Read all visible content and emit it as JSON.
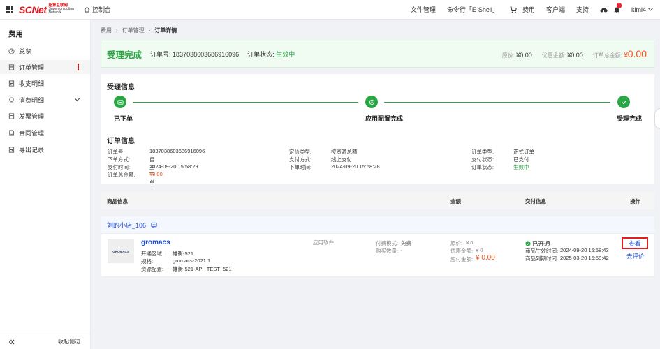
{
  "brand": {
    "logo": "SCNet",
    "sub_cn": "超算互联网",
    "sub_en1": "Supercomputing",
    "sub_en2": "Network"
  },
  "topnav": {
    "console": "控制台",
    "file_manager": "文件管理",
    "eshell": "命令行「E-Shell」",
    "cost": "费用",
    "client": "客户端",
    "support": "支持",
    "notifications": "1",
    "user": "kimi4"
  },
  "sidebar": {
    "title": "费用",
    "items": [
      {
        "label": "总览",
        "icon": "dashboard-icon"
      },
      {
        "label": "订单管理",
        "icon": "order-icon"
      },
      {
        "label": "收支明细",
        "icon": "ledger-icon"
      },
      {
        "label": "消费明细",
        "icon": "consumption-icon"
      },
      {
        "label": "发票管理",
        "icon": "invoice-icon"
      },
      {
        "label": "合同管理",
        "icon": "contract-icon"
      },
      {
        "label": "导出记录",
        "icon": "export-icon"
      }
    ],
    "collapse": "收起侧边"
  },
  "breadcrumb": [
    "费用",
    "订单管理",
    "订单详情"
  ],
  "status": {
    "title": "受理完成",
    "order_no_label": "订单号:",
    "order_no": "1837038603686916096",
    "state_label": "订单状态:",
    "state": "生效中",
    "orig_label": "原价:",
    "orig": "¥0.00",
    "discount_label": "优惠金额:",
    "discount": "¥0.00",
    "total_label": "订单总金额:",
    "total_symbol": "¥",
    "total": "0.00"
  },
  "accept": {
    "title": "受理信息",
    "steps": [
      "已下单",
      "应用配置完成",
      "受理完成"
    ]
  },
  "order_info": {
    "title": "订单信息",
    "col1": [
      {
        "k": "订单号:",
        "v": "1837038603686916096"
      },
      {
        "k": "下单方式:",
        "v": "自主下单"
      },
      {
        "k": "支付时间:",
        "v": "2024-09-20 15:58:29"
      },
      {
        "k": "订单总金额:",
        "v": "¥0.00"
      }
    ],
    "col2": [
      {
        "k": "定价类型:",
        "v": "按资源总额"
      },
      {
        "k": "支付方式:",
        "v": "线上支付"
      },
      {
        "k": "下单时间:",
        "v": "2024-09-20 15:58:28"
      }
    ],
    "col3": [
      {
        "k": "订单类型:",
        "v": "正式订单"
      },
      {
        "k": "支付状态:",
        "v": "已支付"
      },
      {
        "k": "订单状态:",
        "v": "生效中"
      }
    ]
  },
  "table": {
    "headers": [
      "商品信息",
      "金额",
      "交付信息",
      "操作"
    ],
    "shop": "刘的小店_106",
    "product": {
      "thumb_text": "GROMACS",
      "name": "gromacs",
      "region_label": "开通区域:",
      "region": "雄衡-521",
      "spec_label": "规格:",
      "spec": "gromacs-2021.1",
      "res_label": "资源配置:",
      "res": "雄衡-521-API_TEST_521",
      "category": "应用软件",
      "pay_mode_label": "付费模式:",
      "pay_mode": "免费",
      "qty_label": "购买数量:",
      "qty": "-",
      "price_label": "原价:",
      "price": "¥ 0",
      "discount_label": "优惠金额:",
      "discount": "¥ 0",
      "payable_label": "应付金额:",
      "payable": "¥ 0.00",
      "open_status": "已开通",
      "start_label": "商品生效时间:",
      "start": "2024-09-20 15:58:43",
      "end_label": "商品到期时间:",
      "end": "2025-03-20 15:58:42",
      "view": "查看",
      "rate": "去评价"
    }
  },
  "colors": {
    "brand_red": "#d9181e",
    "success_green": "#29a745",
    "link_blue": "#1d4ed8",
    "price_orange": "#f5541e"
  }
}
